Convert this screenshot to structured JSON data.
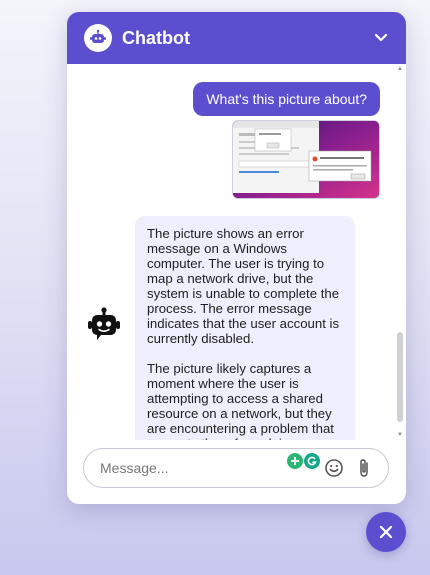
{
  "header": {
    "title": "Chatbot",
    "collapse_icon": "chevron-down-icon",
    "bot_icon": "robot-icon"
  },
  "messages": {
    "user_text": "What's this picture about?",
    "bot_paragraphs": [
      "The picture shows an error message on a Windows computer. The user is trying to map a network drive, but the system is unable to complete the process. The error message indicates that the user account is currently disabled.",
      "The picture likely captures a moment where the user is attempting to access a shared resource on a network, but they are encountering a problem that prevents them from doing so."
    ]
  },
  "input": {
    "placeholder": "Message...",
    "emoji_icon": "smiley-icon",
    "attach_icon": "paperclip-icon"
  },
  "colors": {
    "accent": "#5b4fcf",
    "bot_bubble": "#efeefc"
  }
}
